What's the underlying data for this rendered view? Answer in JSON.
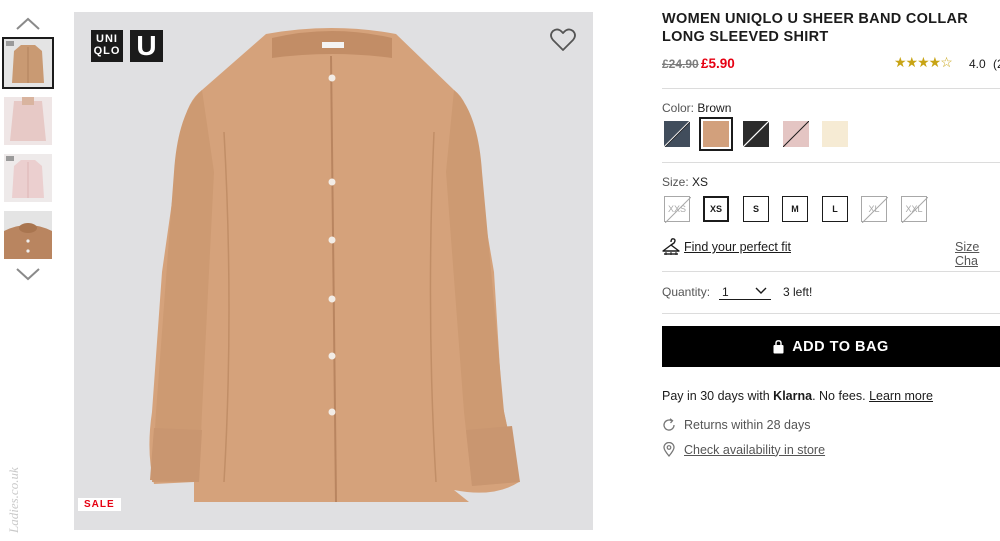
{
  "gallery": {
    "sale_badge": "SALE",
    "brand_logo_text": "UNI QLO",
    "sub_logo_text": "U",
    "thumbnails": [
      {
        "name": "thumb-brown-front",
        "color": "#c99a73"
      },
      {
        "name": "thumb-pink-model-back",
        "color": "#e7c9c6"
      },
      {
        "name": "thumb-pink-front",
        "color": "#ebcfcf"
      },
      {
        "name": "thumb-brown-collar",
        "color": "#b98560"
      }
    ],
    "watermark_text": "Ladies.co.uk"
  },
  "product": {
    "title": "WOMEN UNIQLO U SHEER BAND COLLAR LONG SLEEVED SHIRT",
    "old_price": "£24.90",
    "new_price": "£5.90",
    "stars": "★★★★☆",
    "rating": "4.0",
    "rating_count_partial": "(2",
    "color_label": "Color:",
    "color_value": "Brown",
    "swatches": [
      {
        "name": "navy",
        "hex": "#414d5c",
        "available": false
      },
      {
        "name": "brown",
        "hex": "#d2a07c",
        "available": true,
        "selected": true
      },
      {
        "name": "black",
        "hex": "#2b2b2b",
        "available": false
      },
      {
        "name": "pink",
        "hex": "#e4c5c3",
        "available": false
      },
      {
        "name": "off-white",
        "hex": "#f6ebd4",
        "available": true
      }
    ],
    "size_label": "Size:",
    "size_value": "XS",
    "sizes": [
      {
        "label": "XXS",
        "available": false
      },
      {
        "label": "XS",
        "available": true,
        "selected": true
      },
      {
        "label": "S",
        "available": true
      },
      {
        "label": "M",
        "available": true
      },
      {
        "label": "L",
        "available": true
      },
      {
        "label": "XL",
        "available": false
      },
      {
        "label": "XXL",
        "available": false
      }
    ],
    "fit_link": "Find your perfect fit",
    "size_chart_link": "Size Cha",
    "quantity_label": "Quantity:",
    "quantity_value": "1",
    "stock_text": "3 left!",
    "add_to_bag": "ADD TO BAG",
    "pay_prefix": "Pay in 30 days with ",
    "pay_brand": "Klarna",
    "pay_suffix": ". No fees. ",
    "pay_learn_more": "Learn more",
    "returns_text": "Returns within 28 days",
    "store_link": "Check availability in store"
  },
  "colors": {
    "accent_red": "#e60012",
    "black": "#000000",
    "divider": "#dcdcdc",
    "star": "#c8a415",
    "shirt": "#d5a27b"
  }
}
